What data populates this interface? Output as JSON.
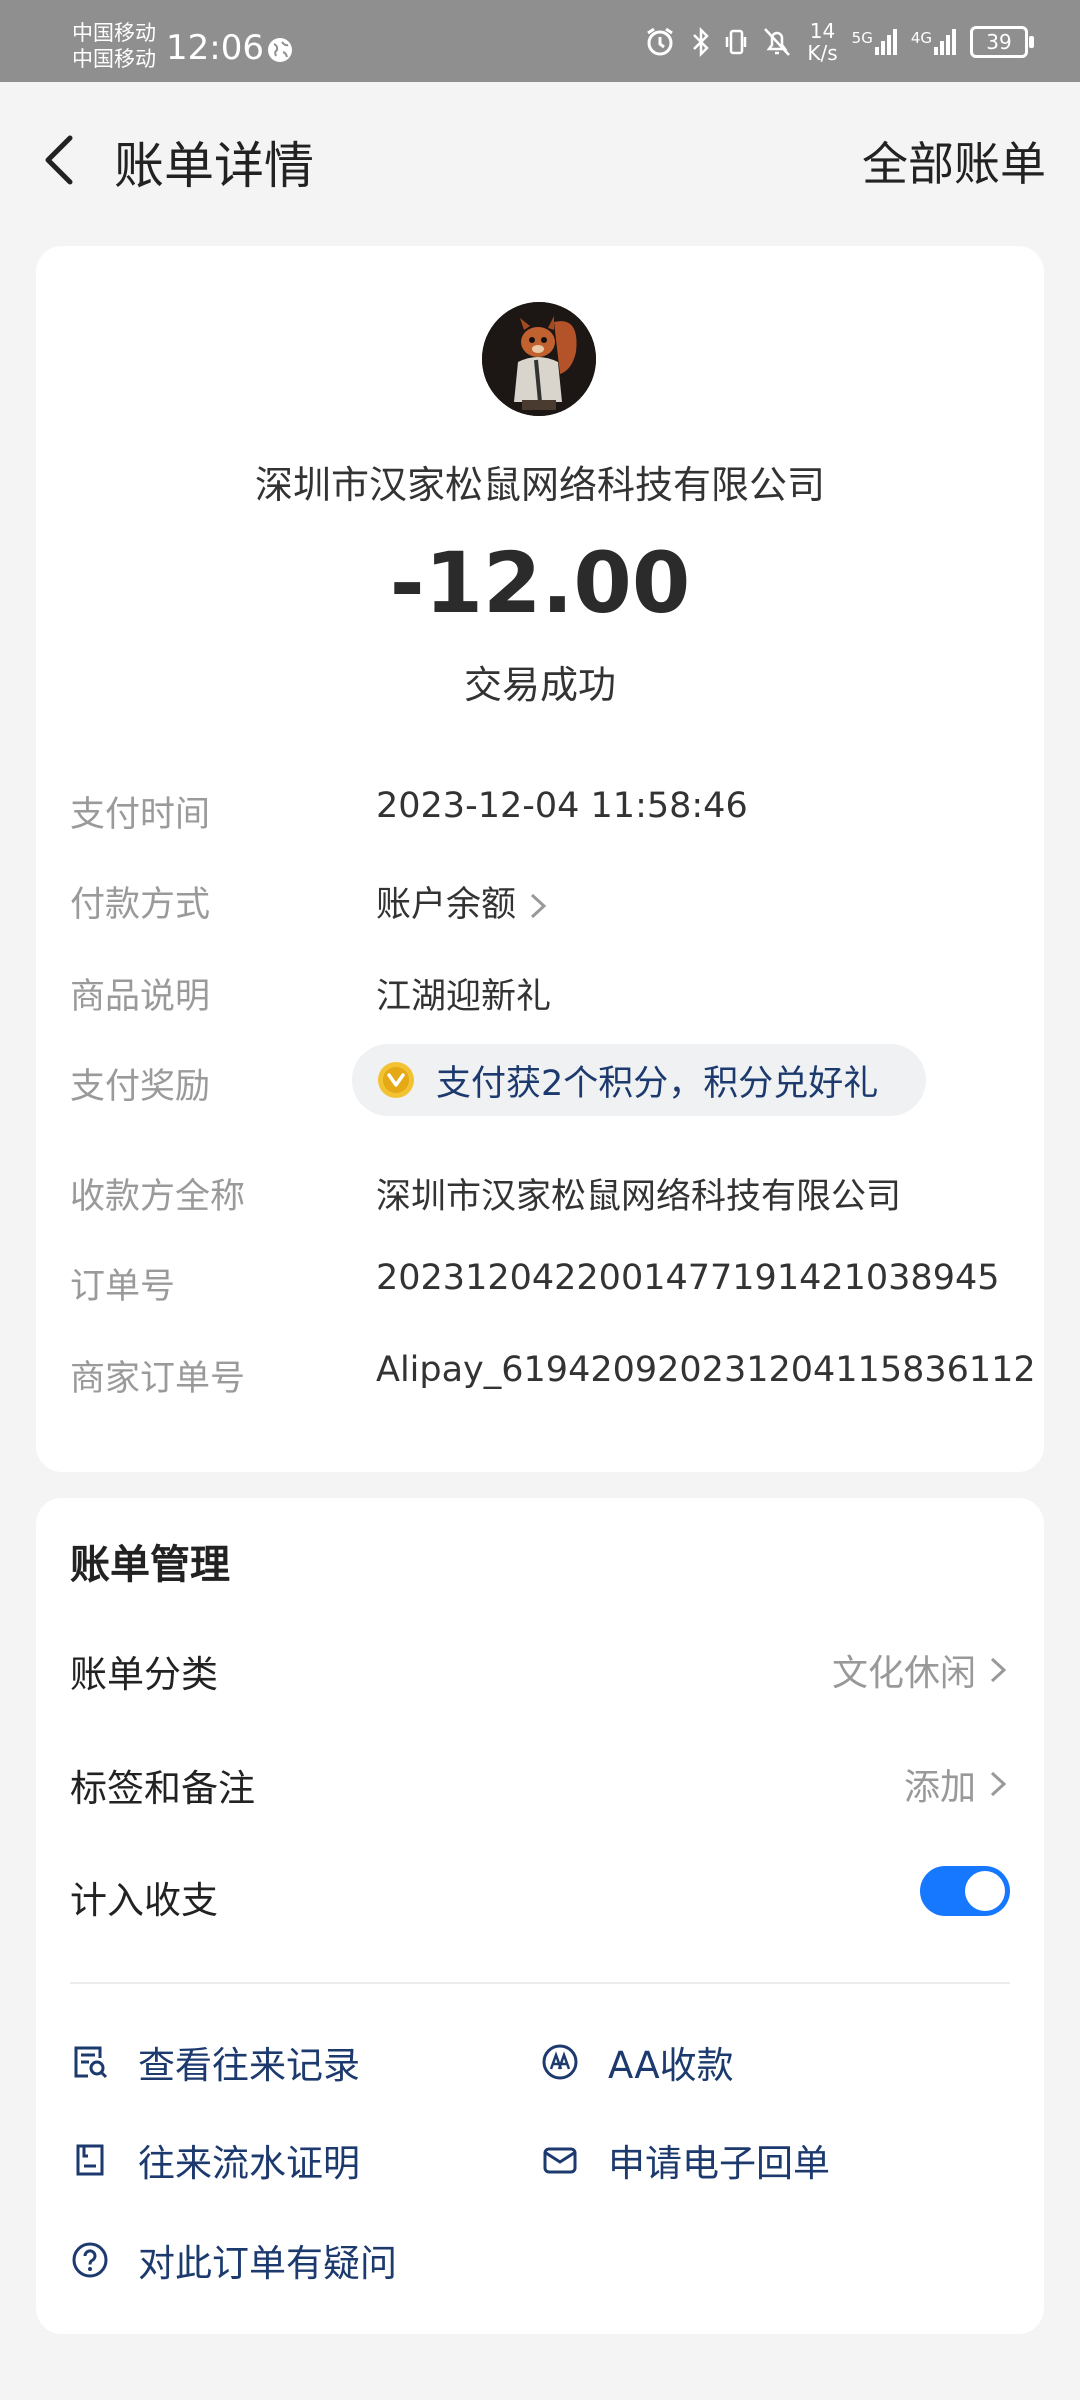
{
  "status_bar": {
    "carrier_1": "中国移动",
    "carrier_2": "中国移动",
    "time": "12:06",
    "net_speed_value": "14",
    "net_speed_unit": "K/s",
    "signal_1": "5G",
    "signal_2": "4G",
    "battery": "39"
  },
  "header": {
    "title": "账单详情",
    "all_bills": "全部账单"
  },
  "bill": {
    "merchant": "深圳市汉家松鼠网络科技有限公司",
    "amount": "-12.00",
    "status": "交易成功",
    "rows": [
      {
        "label": "支付时间",
        "value": "2023-12-04 11:58:46"
      },
      {
        "label": "付款方式",
        "value": "账户余额"
      },
      {
        "label": "商品说明",
        "value": "江湖迎新礼"
      },
      {
        "label": "支付奖励",
        "value": "支付获2个积分，积分兑好礼"
      },
      {
        "label": "收款方全称",
        "value": "深圳市汉家松鼠网络科技有限公司"
      },
      {
        "label": "订单号",
        "value": "2023120422001477191421038945"
      },
      {
        "label": "商家订单号",
        "value": "Alipay_61942092023120411583611​2"
      }
    ]
  },
  "manage": {
    "title": "账单管理",
    "category_label": "账单分类",
    "category_value": "文化休闲",
    "tags_label": "标签和备注",
    "tags_value": "添加",
    "include_label": "计入收支",
    "include_on": true,
    "actions": {
      "history": "查看往来记录",
      "aa": "AA收款",
      "flow_proof": "往来流水证明",
      "receipt": "申请电子回单",
      "question": "对此订单有疑问"
    }
  },
  "colors": {
    "accent_blue": "#1677ff",
    "link_navy": "#1c3a6e",
    "status_bar_gray": "#8f8f8f"
  }
}
